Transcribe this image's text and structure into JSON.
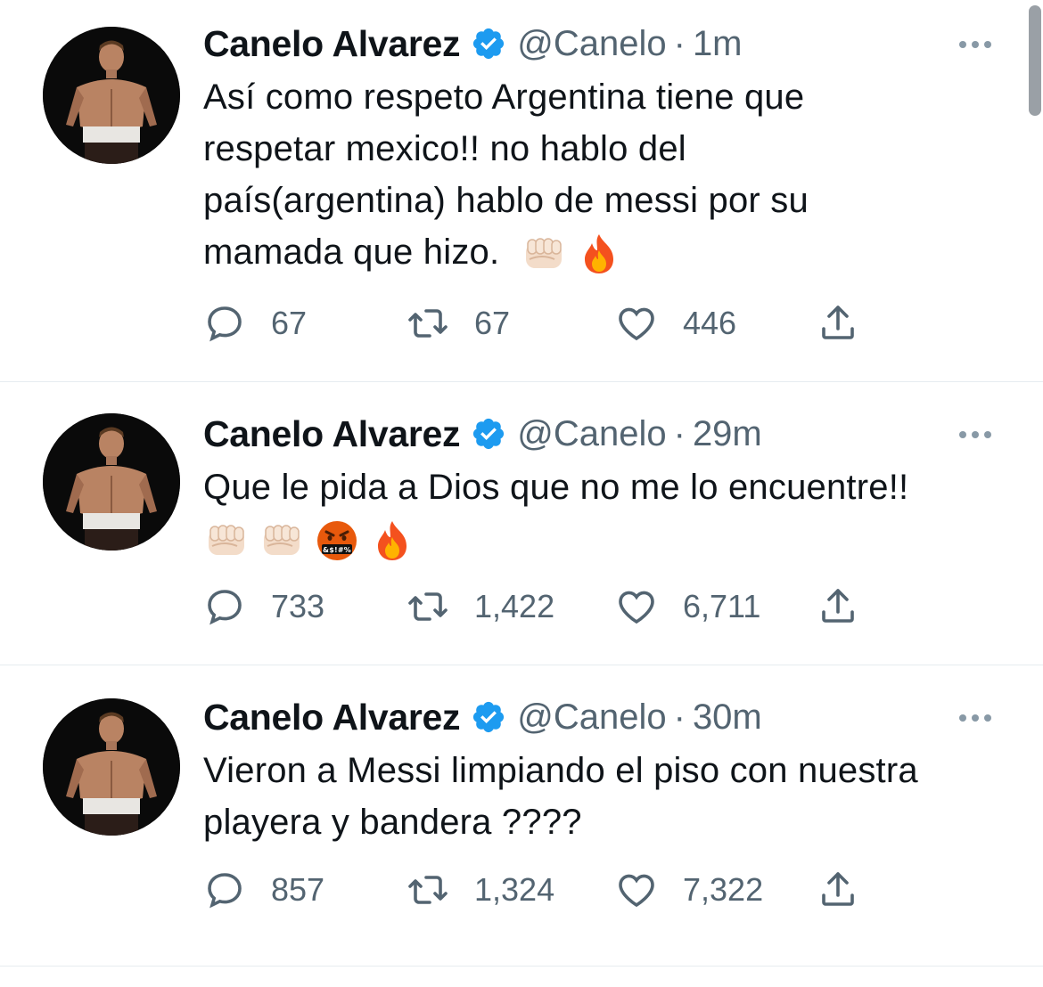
{
  "tweets": [
    {
      "author_name": "Canelo Alvarez",
      "handle": "@Canelo",
      "separator": "·",
      "time": "1m",
      "text_lines": [
        "Así como respeto Argentina tiene que",
        "respetar mexico!! no hablo del",
        "país(argentina) hablo de messi por su",
        "mamada que hizo."
      ],
      "emojis": [
        "fist-icon",
        "fire-icon"
      ],
      "replies": "67",
      "retweets": "67",
      "likes": "446"
    },
    {
      "author_name": "Canelo Alvarez",
      "handle": "@Canelo",
      "separator": "·",
      "time": "29m",
      "text_lines": [
        "Que le pida a Dios que no me lo encuentre!!"
      ],
      "emojis": [
        "fist-icon",
        "fist-icon",
        "cursing-face-icon",
        "fire-icon"
      ],
      "replies": "733",
      "retweets": "1,422",
      "likes": "6,711"
    },
    {
      "author_name": "Canelo Alvarez",
      "handle": "@Canelo",
      "separator": "·",
      "time": "30m",
      "text_lines": [
        "Vieron a Messi limpiando el piso con nuestra",
        "playera y bandera ????"
      ],
      "emojis": [],
      "replies": "857",
      "retweets": "1,324",
      "likes": "7,322"
    }
  ],
  "colors": {
    "verified_blue": "#1d9bf0",
    "secondary_text": "#536471",
    "primary_text": "#0f1419",
    "divider": "#e6ecf0"
  }
}
